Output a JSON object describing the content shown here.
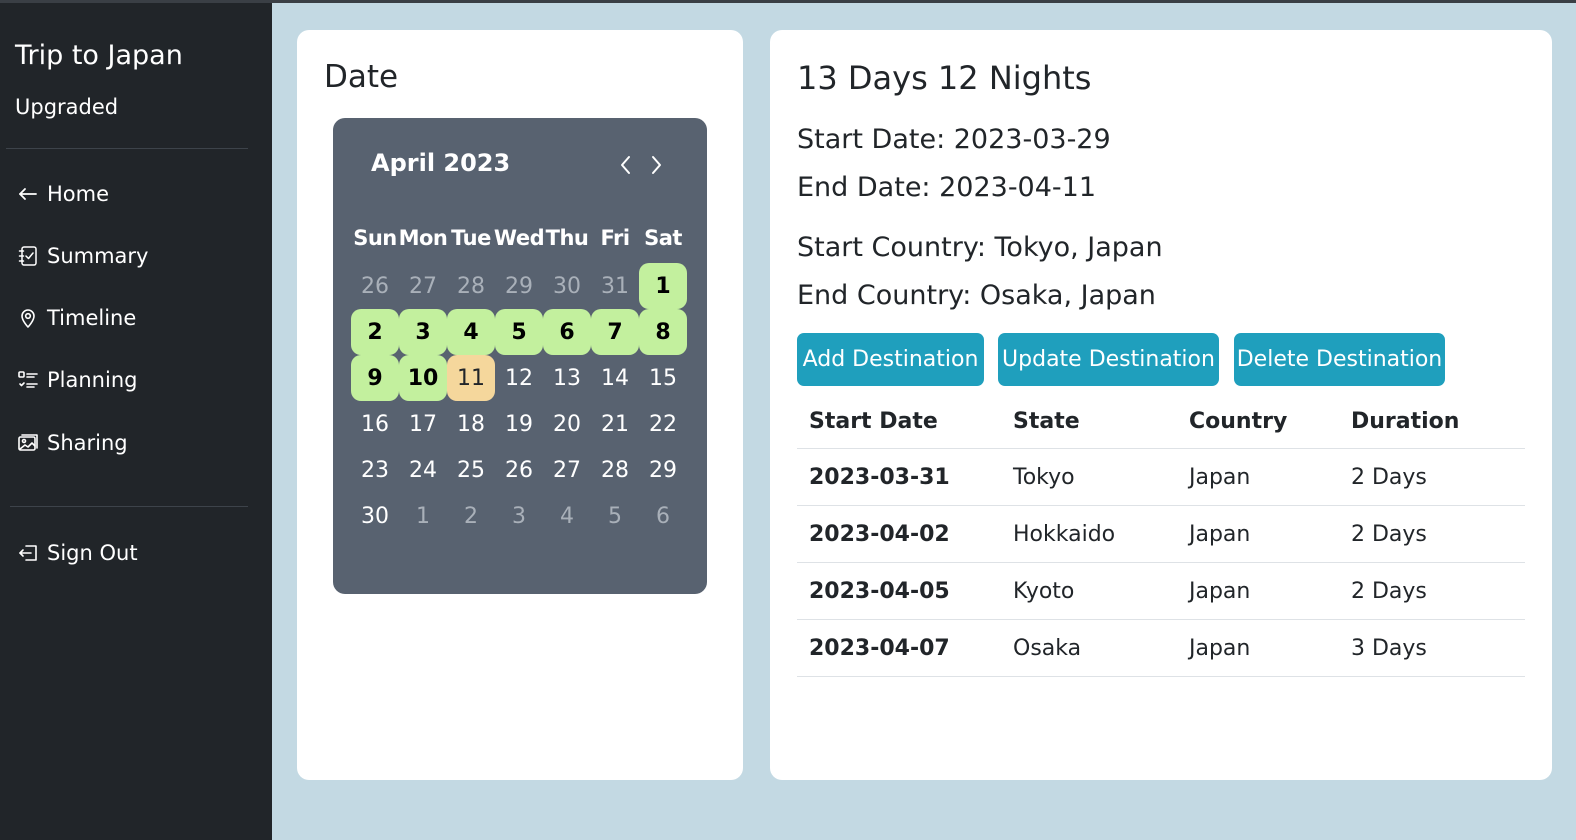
{
  "sidebar": {
    "title": "Trip to Japan",
    "plan": "Upgraded",
    "items": [
      {
        "label": "Home",
        "icon": "arrow-left-icon"
      },
      {
        "label": "Summary",
        "icon": "journal-check-icon"
      },
      {
        "label": "Timeline",
        "icon": "geo-pin-icon"
      },
      {
        "label": "Planning",
        "icon": "list-check-icon"
      },
      {
        "label": "Sharing",
        "icon": "images-icon"
      }
    ],
    "signout": {
      "label": "Sign Out",
      "icon": "box-arrow-left-icon"
    }
  },
  "date_card": {
    "title": "Date",
    "calendar": {
      "month_label": "April 2023",
      "weekdays": [
        "Sun",
        "Mon",
        "Tue",
        "Wed",
        "Thu",
        "Fri",
        "Sat"
      ],
      "weeks": [
        [
          {
            "d": "26",
            "s": "other"
          },
          {
            "d": "27",
            "s": "other"
          },
          {
            "d": "28",
            "s": "other"
          },
          {
            "d": "29",
            "s": "other"
          },
          {
            "d": "30",
            "s": "other"
          },
          {
            "d": "31",
            "s": "other"
          },
          {
            "d": "1",
            "s": "trip"
          }
        ],
        [
          {
            "d": "2",
            "s": "trip"
          },
          {
            "d": "3",
            "s": "trip"
          },
          {
            "d": "4",
            "s": "trip"
          },
          {
            "d": "5",
            "s": "trip"
          },
          {
            "d": "6",
            "s": "trip"
          },
          {
            "d": "7",
            "s": "trip"
          },
          {
            "d": "8",
            "s": "trip"
          }
        ],
        [
          {
            "d": "9",
            "s": "trip"
          },
          {
            "d": "10",
            "s": "trip"
          },
          {
            "d": "11",
            "s": "today"
          },
          {
            "d": "12",
            "s": ""
          },
          {
            "d": "13",
            "s": ""
          },
          {
            "d": "14",
            "s": ""
          },
          {
            "d": "15",
            "s": ""
          }
        ],
        [
          {
            "d": "16",
            "s": ""
          },
          {
            "d": "17",
            "s": ""
          },
          {
            "d": "18",
            "s": ""
          },
          {
            "d": "19",
            "s": ""
          },
          {
            "d": "20",
            "s": ""
          },
          {
            "d": "21",
            "s": ""
          },
          {
            "d": "22",
            "s": ""
          }
        ],
        [
          {
            "d": "23",
            "s": ""
          },
          {
            "d": "24",
            "s": ""
          },
          {
            "d": "25",
            "s": ""
          },
          {
            "d": "26",
            "s": ""
          },
          {
            "d": "27",
            "s": ""
          },
          {
            "d": "28",
            "s": ""
          },
          {
            "d": "29",
            "s": ""
          }
        ],
        [
          {
            "d": "30",
            "s": ""
          },
          {
            "d": "1",
            "s": "other"
          },
          {
            "d": "2",
            "s": "other"
          },
          {
            "d": "3",
            "s": "other"
          },
          {
            "d": "4",
            "s": "other"
          },
          {
            "d": "5",
            "s": "other"
          },
          {
            "d": "6",
            "s": "other"
          }
        ]
      ]
    }
  },
  "trip": {
    "title": "13 Days 12 Nights",
    "start_date": "Start Date: 2023-03-29",
    "end_date": "End Date: 2023-04-11",
    "start_country": "Start Country: Tokyo, Japan",
    "end_country": "End Country: Osaka, Japan",
    "buttons": {
      "add": "Add Destination",
      "update": "Update Destination",
      "delete": "Delete Destination"
    },
    "table": {
      "headers": [
        "Start Date",
        "State",
        "Country",
        "Duration"
      ],
      "rows": [
        [
          "2023-03-31",
          "Tokyo",
          "Japan",
          "2 Days"
        ],
        [
          "2023-04-02",
          "Hokkaido",
          "Japan",
          "2 Days"
        ],
        [
          "2023-04-05",
          "Kyoto",
          "Japan",
          "2 Days"
        ],
        [
          "2023-04-07",
          "Osaka",
          "Japan",
          "3 Days"
        ]
      ]
    }
  },
  "colors": {
    "sidebar_bg": "#212529",
    "page_bg": "#c3d9e3",
    "calendar_bg": "#586270",
    "trip_day": "#c3f09e",
    "today": "#f5d79c",
    "button": "#1f9fbd"
  }
}
